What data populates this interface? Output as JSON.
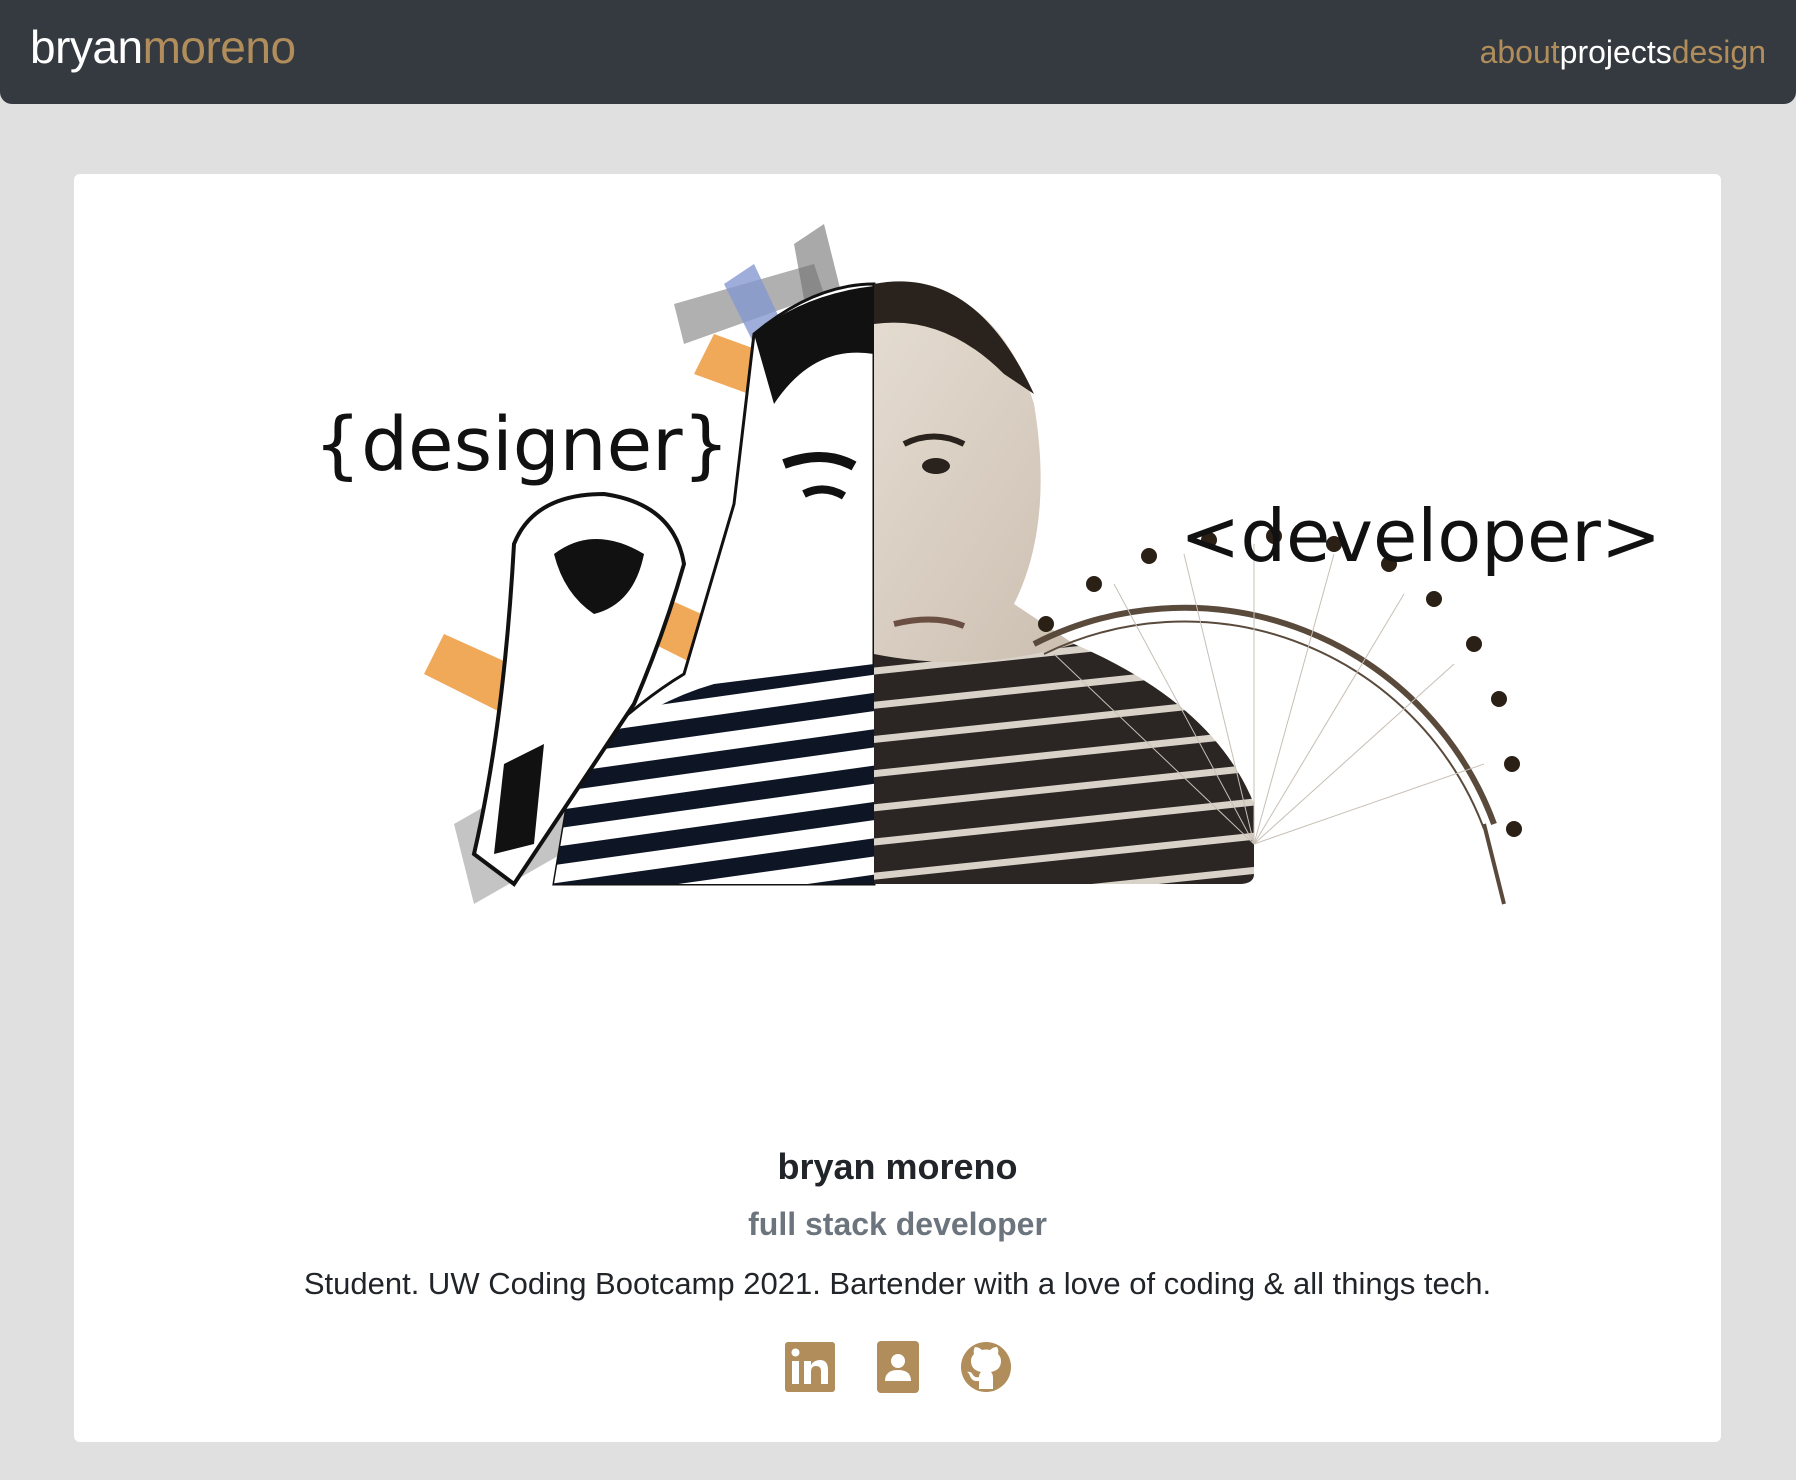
{
  "navbar": {
    "brand_first": "bryan",
    "brand_last": "moreno",
    "links": [
      "about",
      "projects",
      "design"
    ]
  },
  "hero": {
    "left_word": "{designer}",
    "right_word": "<developer>"
  },
  "profile": {
    "name": "bryan moreno",
    "role": "full stack developer",
    "bio": "Student. UW Coding Bootcamp 2021. Bartender with a love of coding & all things tech."
  },
  "socials": [
    {
      "icon": "linkedin-icon"
    },
    {
      "icon": "contact-card-icon"
    },
    {
      "icon": "github-icon"
    }
  ],
  "colors": {
    "accent": "#b08d5a",
    "navbar": "#343a40",
    "background": "#e0e0e0"
  }
}
